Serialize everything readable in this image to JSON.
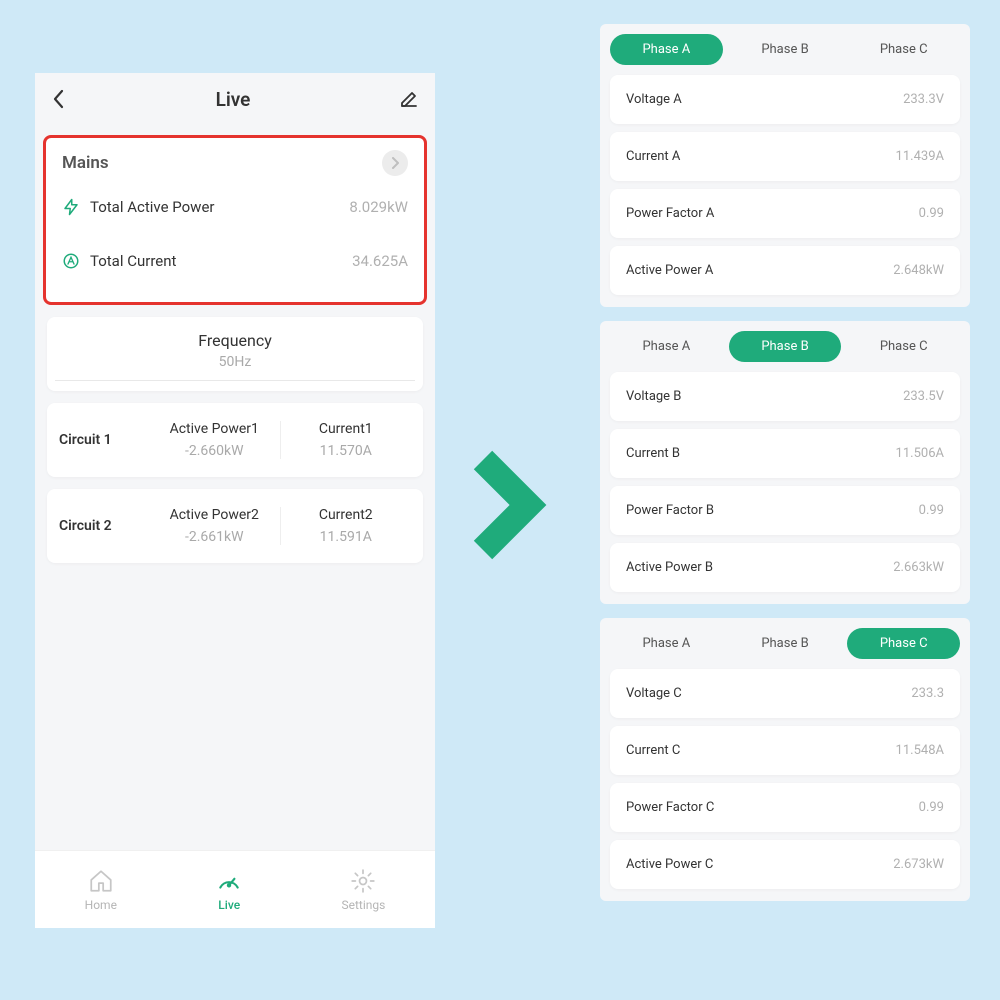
{
  "phone": {
    "title": "Live",
    "mains": {
      "title": "Mains",
      "total_active_power_label": "Total Active Power",
      "total_active_power_value": "8.029kW",
      "total_current_label": "Total Current",
      "total_current_value": "34.625A"
    },
    "frequency": {
      "label": "Frequency",
      "value": "50Hz"
    },
    "circuits": [
      {
        "name": "Circuit 1",
        "active_power_label": "Active Power1",
        "active_power_value": "-2.660kW",
        "current_label": "Current1",
        "current_value": "11.570A"
      },
      {
        "name": "Circuit 2",
        "active_power_label": "Active Power2",
        "active_power_value": "-2.661kW",
        "current_label": "Current2",
        "current_value": "11.591A"
      }
    ],
    "nav": {
      "home": "Home",
      "live": "Live",
      "settings": "Settings"
    }
  },
  "phases": {
    "a": {
      "tabs": [
        "Phase A",
        "Phase B",
        "Phase C"
      ],
      "active": 0,
      "rows": [
        {
          "label": "Voltage A",
          "value": "233.3V"
        },
        {
          "label": "Current A",
          "value": "11.439A"
        },
        {
          "label": "Power Factor A",
          "value": "0.99"
        },
        {
          "label": "Active Power A",
          "value": "2.648kW"
        }
      ]
    },
    "b": {
      "tabs": [
        "Phase A",
        "Phase B",
        "Phase C"
      ],
      "active": 1,
      "rows": [
        {
          "label": "Voltage B",
          "value": "233.5V"
        },
        {
          "label": "Current B",
          "value": "11.506A"
        },
        {
          "label": "Power Factor B",
          "value": "0.99"
        },
        {
          "label": "Active Power B",
          "value": "2.663kW"
        }
      ]
    },
    "c": {
      "tabs": [
        "Phase A",
        "Phase B",
        "Phase C"
      ],
      "active": 2,
      "rows": [
        {
          "label": "Voltage C",
          "value": "233.3"
        },
        {
          "label": "Current C",
          "value": "11.548A"
        },
        {
          "label": "Power Factor C",
          "value": "0.99"
        },
        {
          "label": "Active Power C",
          "value": "2.673kW"
        }
      ]
    }
  }
}
